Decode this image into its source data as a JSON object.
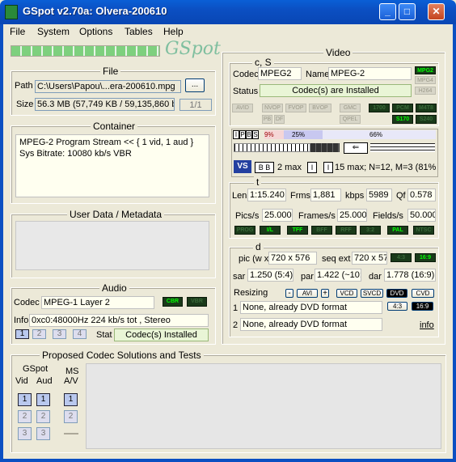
{
  "window": {
    "title": "GSpot v2.70a: Olvera-200610"
  },
  "menu": [
    "File",
    "System",
    "Options",
    "Tables",
    "Help"
  ],
  "logo": "GSpot",
  "file": {
    "title": "File",
    "path_label": "Path",
    "path_value": "C:\\Users\\Papou\\...era-200610.mpg",
    "browse_label": "...",
    "size_label": "Size",
    "size_value": "56.3 MB (57,749 KB / 59,135,860 b",
    "part_label": "1/1"
  },
  "container": {
    "title": "Container",
    "line1": "MPEG-2 Program Stream << { 1 vid, 1 aud }",
    "line2": "Sys Bitrate: 10080 kb/s VBR"
  },
  "userdata": {
    "title": "User Data / Metadata"
  },
  "audio": {
    "title": "Audio",
    "codec_label": "Codec",
    "codec_value": "MPEG-1 Layer 2",
    "cbr": "CBR",
    "vbr": "VBR",
    "info_label": "Info",
    "info_value": "0xc0:48000Hz  224 kb/s tot , Stereo",
    "streams": [
      "1",
      "2",
      "3",
      "4"
    ],
    "stat_label": "Stat",
    "stat_value": "Codec(s) Installed"
  },
  "video": {
    "title": "Video",
    "cs_title": "c, S",
    "codec_label": "Codec",
    "codec_value": "MPEG2",
    "name_label": "Name",
    "name_value": "MPEG-2",
    "status_label": "Status",
    "status_value": "Codec(s) are Installed",
    "std_leds": [
      "MPG2",
      "MPG4",
      "H264"
    ],
    "feature_row1": [
      "AVID",
      "NVOP",
      "FVOP",
      "BVOP",
      "GMC",
      "1700",
      "PCM",
      "M4T8"
    ],
    "feature_row2": [
      "PB",
      "DF",
      "QPEL",
      "S170",
      "S240"
    ],
    "frame_types": [
      "I",
      "P",
      "B",
      "S"
    ],
    "pct_i": "9%",
    "pct_p": "25%",
    "pct_b": "66%",
    "bmax": "2 max",
    "gop": "15 max; N=12, M=3 (81%",
    "t_title": "t",
    "len_label": "Len",
    "len_value": "1:15.240",
    "frms_label": "Frms",
    "frms_value": "1,881",
    "kbps_label": "kbps",
    "kbps_value": "5989",
    "qf_label": "Qf",
    "qf_value": "0.578",
    "pics_label": "Pics/s",
    "pics_value": "25.000",
    "frames_label": "Frames/s",
    "frames_value": "25.000",
    "fields_label": "Fields/s",
    "fields_value": "50.000",
    "scan_leds": [
      "PROG",
      "I/L",
      "TFF",
      "BFF",
      "RFF",
      "3:2",
      "PAL",
      "NTSC"
    ],
    "d_title": "d",
    "pic_label": "pic (w x",
    "pic_value": "720 x 576",
    "seq_label": "seq ext",
    "seq_value": "720 x 57",
    "ar_leds": [
      "4:3",
      "16:9"
    ],
    "sar_label": "sar",
    "sar_value": "1.250 (5:4)",
    "par_label": "par",
    "par_value": "1.422 (~10:",
    "dar_label": "dar",
    "dar_value": "1.778 (16:9)",
    "resizing_label": "Resizing",
    "avi_label": "AVI",
    "fmt_buttons": [
      "VCD",
      "SVCD",
      "DVD",
      "CVD"
    ],
    "r1_num": "1",
    "r1_value": "None, already DVD format",
    "r2_num": "2",
    "r2_value": "None, already DVD format",
    "info_link": "info"
  },
  "proposed": {
    "title": "Proposed Codec Solutions and Tests",
    "gspot_label": "GSpot",
    "vid_label": "Vid",
    "aud_label": "Aud",
    "ms_label": "MS",
    "av_label": "A/V",
    "numbers": [
      "1",
      "2",
      "3"
    ]
  }
}
